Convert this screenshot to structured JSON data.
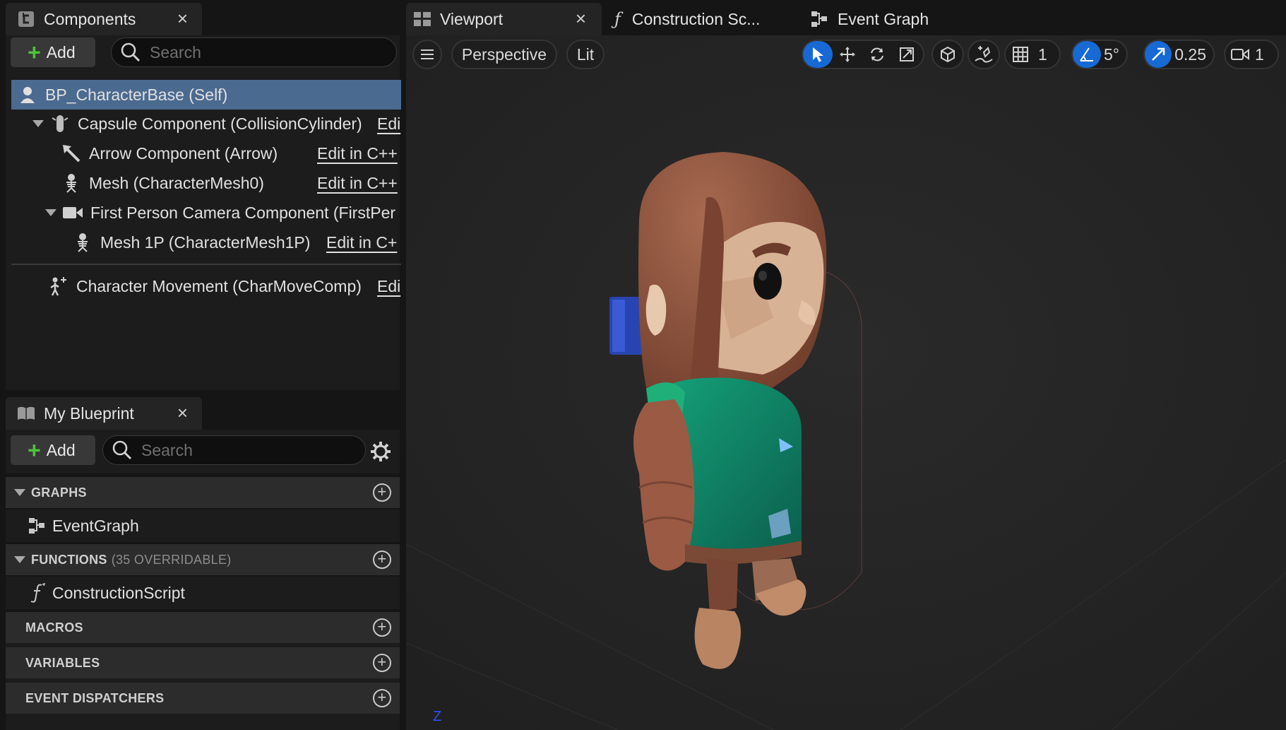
{
  "components_panel": {
    "tab_title": "Components",
    "close": "×",
    "add_label": "Add",
    "search_placeholder": "Search",
    "tree": [
      {
        "label": "BP_CharacterBase (Self)",
        "edit": ""
      },
      {
        "label": "Capsule Component (CollisionCylinder)",
        "edit": "Edi"
      },
      {
        "label": "Arrow Component (Arrow)",
        "edit": "Edit in C++"
      },
      {
        "label": "Mesh (CharacterMesh0)",
        "edit": "Edit in C++"
      },
      {
        "label": "First Person Camera Component (FirstPer",
        "edit": ""
      },
      {
        "label": "Mesh 1P (CharacterMesh1P)",
        "edit": "Edit in C+"
      },
      {
        "label": "Character Movement (CharMoveComp)",
        "edit": "Edi"
      }
    ]
  },
  "my_blueprint": {
    "tab_title": "My Blueprint",
    "close": "×",
    "add_label": "Add",
    "search_placeholder": "Search",
    "sections": {
      "graphs": {
        "title": "GRAPHS",
        "items": [
          "EventGraph"
        ]
      },
      "functions": {
        "title": "FUNCTIONS",
        "sub": "(35 OVERRIDABLE)",
        "items": [
          "ConstructionScript"
        ]
      },
      "macros": {
        "title": "MACROS"
      },
      "variables": {
        "title": "VARIABLES"
      },
      "event_dispatchers": {
        "title": "EVENT DISPATCHERS"
      }
    }
  },
  "editor_tabs": {
    "viewport": "Viewport",
    "viewport_close": "×",
    "construction": "Construction Sc...",
    "event_graph": "Event Graph"
  },
  "viewport_toolbar": {
    "view_mode": "Perspective",
    "lighting": "Lit",
    "grid_snap": "1",
    "rotation_snap": "5°",
    "scale_snap": "0.25",
    "camera_speed": "1"
  },
  "viewport": {
    "axis_label": "Z"
  },
  "colors": {
    "accent": "#1769d4",
    "add_plus": "#4fc23d",
    "selected_row": "#4b6a90"
  }
}
